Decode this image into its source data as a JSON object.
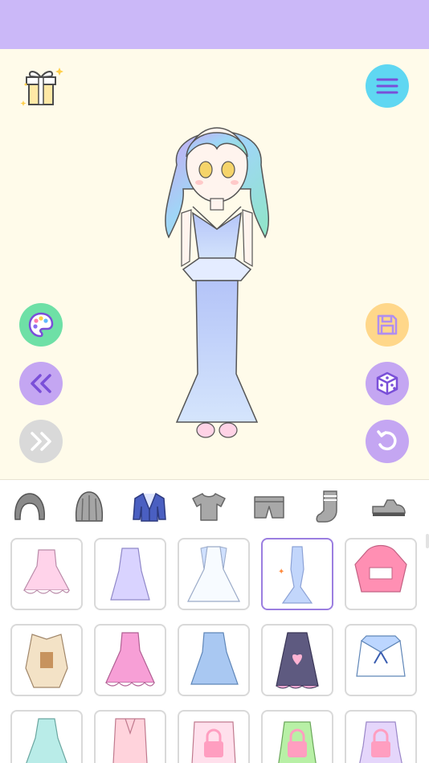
{
  "app": {
    "colors": {
      "top_bar": "#cbb8f8",
      "stage": "#fffbea",
      "menu": "#5fd7f2",
      "palette": "#6ee0a6",
      "nav": "#c4a6f2",
      "save": "#ffd78a",
      "selected": "#9b7ee0"
    }
  },
  "left_buttons": [
    {
      "name": "palette-button",
      "icon": "palette-icon"
    },
    {
      "name": "previous-button",
      "icon": "double-chevron-left-icon"
    },
    {
      "name": "next-button",
      "icon": "double-chevron-right-icon",
      "disabled": true
    }
  ],
  "right_buttons": [
    {
      "name": "menu-button",
      "icon": "hamburger-menu-icon"
    },
    {
      "name": "save-button",
      "icon": "floppy-disk-icon"
    },
    {
      "name": "random-button",
      "icon": "dice-icon"
    },
    {
      "name": "reset-button",
      "icon": "undo-icon"
    }
  ],
  "categories": [
    {
      "icon": "hair-icon"
    },
    {
      "icon": "back-hair-icon"
    },
    {
      "icon": "jacket-icon",
      "active": true
    },
    {
      "icon": "shirt-icon"
    },
    {
      "icon": "shorts-icon"
    },
    {
      "icon": "sock-icon"
    },
    {
      "icon": "shoe-icon"
    }
  ],
  "outfits": [
    {
      "icon": "pink-frilly-dress",
      "selected": false,
      "locked": false
    },
    {
      "icon": "lavender-dress",
      "selected": false,
      "locked": false
    },
    {
      "icon": "white-gown",
      "selected": false,
      "locked": false
    },
    {
      "icon": "blue-mermaid-gown",
      "selected": true,
      "locked": false
    },
    {
      "icon": "pink-hoodie",
      "selected": false,
      "locked": false
    },
    {
      "icon": "beige-coat",
      "selected": false,
      "locked": false
    },
    {
      "icon": "pink-ruffle-dress",
      "selected": false,
      "locked": false
    },
    {
      "icon": "blue-shirt-dress",
      "selected": false,
      "locked": false
    },
    {
      "icon": "navy-heart-dress",
      "selected": false,
      "locked": false
    },
    {
      "icon": "sailor-top",
      "selected": false,
      "locked": false
    },
    {
      "icon": "mint-gown",
      "selected": false,
      "locked": false
    },
    {
      "icon": "pink-kimono",
      "selected": false,
      "locked": false
    },
    {
      "icon": "pink-robe",
      "selected": false,
      "locked": true
    },
    {
      "icon": "green-dress",
      "selected": false,
      "locked": true
    },
    {
      "icon": "lilac-dress",
      "selected": false,
      "locked": true
    }
  ]
}
